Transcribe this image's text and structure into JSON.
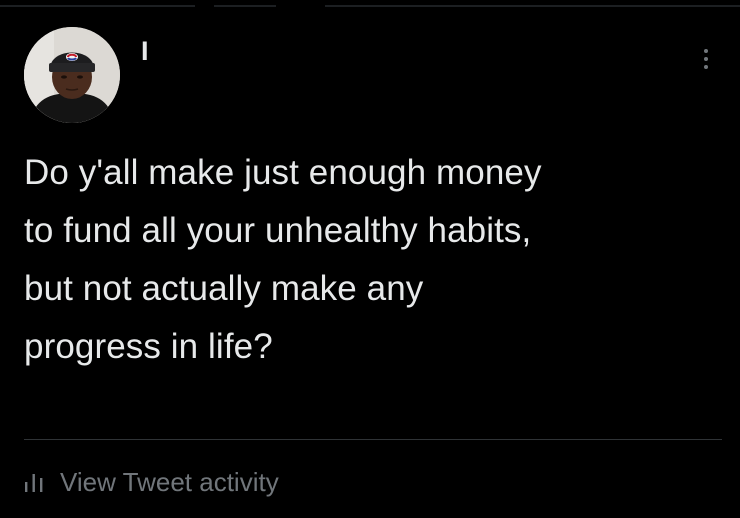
{
  "tweet": {
    "author_name": "I",
    "text": "Do y'all make just enough money\nto fund all your unhealthy habits,\nbut not actually make any\nprogress in life?",
    "more_icon": "more-vertical-icon"
  },
  "footer": {
    "activity_label": "View Tweet activity",
    "activity_icon": "analytics-bars-icon"
  },
  "colors": {
    "background": "#000000",
    "text_primary": "#e7e9ea",
    "text_secondary": "#71767b",
    "divider": "#2f3336"
  }
}
